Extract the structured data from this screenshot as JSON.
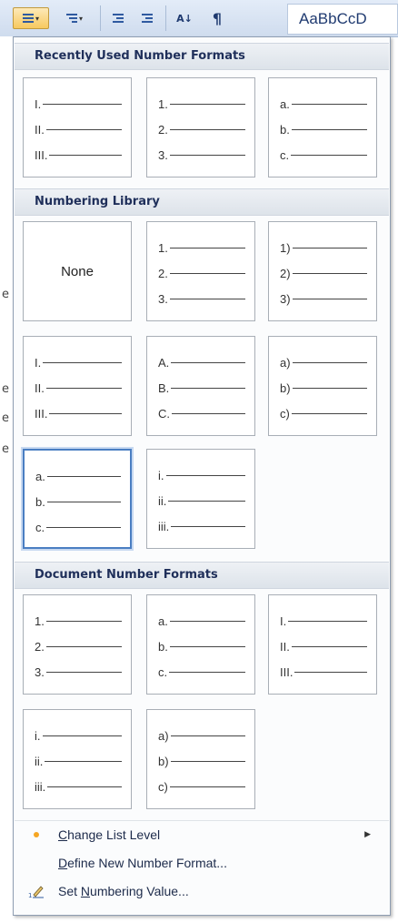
{
  "toolbar": {
    "styles_preview": "AaBbCcD"
  },
  "sections": {
    "recent": {
      "title": "Recently Used Number Formats"
    },
    "library": {
      "title": "Numbering Library",
      "none_label": "None"
    },
    "document": {
      "title": "Document Number Formats"
    }
  },
  "tiles": {
    "recent": [
      [
        "I.",
        "II.",
        "III."
      ],
      [
        "1.",
        "2.",
        "3."
      ],
      [
        "a.",
        "b.",
        "c."
      ]
    ],
    "library": [
      [
        "1.",
        "2.",
        "3."
      ],
      [
        "1)",
        "2)",
        "3)"
      ],
      [
        "I.",
        "II.",
        "III."
      ],
      [
        "A.",
        "B.",
        "C."
      ],
      [
        "a)",
        "b)",
        "c)"
      ],
      [
        "a.",
        "b.",
        "c."
      ],
      [
        "i.",
        "ii.",
        "iii."
      ]
    ],
    "document": [
      [
        "1.",
        "2.",
        "3."
      ],
      [
        "a.",
        "b.",
        "c."
      ],
      [
        "I.",
        "II.",
        "III."
      ],
      [
        "i.",
        "ii.",
        "iii."
      ],
      [
        "a)",
        "b)",
        "c)"
      ]
    ]
  },
  "menu": {
    "change_level": {
      "pre": "",
      "key": "C",
      "post": "hange List Level",
      "icon": "bullet-dot-icon"
    },
    "define_new": {
      "pre": "",
      "key": "D",
      "post": "efine New Number Format...",
      "icon": ""
    },
    "set_value": {
      "pre": "Set ",
      "key": "N",
      "post": "umbering Value...",
      "icon": "numbering-value-pencil-icon"
    }
  },
  "colors": {
    "selected_border": "#4a7ec2",
    "header_text": "#1f2f5a",
    "bullet": "#f5a623"
  },
  "background_fragments": [
    "e",
    "e",
    "e",
    "e"
  ]
}
